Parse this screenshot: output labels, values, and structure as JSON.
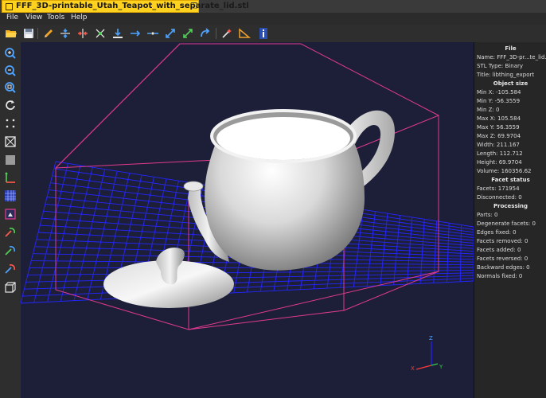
{
  "window": {
    "title": "FFF_3D-printable_Utah_Teapot_with_separate_lid.stl"
  },
  "menu": [
    "File",
    "View",
    "Tools",
    "Help"
  ],
  "toolbar": [
    {
      "name": "open-file-icon"
    },
    {
      "name": "save-file-icon"
    },
    {
      "name": "edit-pencil-icon"
    },
    {
      "name": "mirror-horizontal-icon"
    },
    {
      "name": "mirror-vertical-icon"
    },
    {
      "name": "fix-icon"
    },
    {
      "name": "put-on-bed-icon"
    },
    {
      "name": "translate-icon"
    },
    {
      "name": "center-icon"
    },
    {
      "name": "scale-icon"
    },
    {
      "name": "scale-axis-icon"
    },
    {
      "name": "rotate-icon"
    },
    {
      "name": "repair-icon"
    },
    {
      "name": "measure-icon"
    },
    {
      "name": "info-icon"
    }
  ],
  "left_toolbar": [
    {
      "name": "zoom-in-icon"
    },
    {
      "name": "zoom-out-icon"
    },
    {
      "name": "zoom-fit-icon"
    },
    {
      "name": "reset-view-icon"
    },
    {
      "name": "points-view-icon"
    },
    {
      "name": "wireframe-view-icon"
    },
    {
      "name": "solid-view-icon"
    },
    {
      "name": "axes-icon"
    },
    {
      "name": "grid-icon"
    },
    {
      "name": "bounding-box-icon"
    },
    {
      "name": "rotate-x-icon"
    },
    {
      "name": "rotate-y-icon"
    },
    {
      "name": "rotate-z-icon"
    },
    {
      "name": "perspective-icon"
    }
  ],
  "viewport": {
    "background": "#1d1f38",
    "grid_color": "#2426ff",
    "bbox_color": "#e03a8e",
    "axes": {
      "x": "X",
      "y": "Y",
      "z": "Z"
    }
  },
  "info": {
    "file_header": "File",
    "name": "Name: FFF_3D-pr...te_lid.stl",
    "stl_type": "STL Type: Binary",
    "title": "Title: libthing_export",
    "size_header": "Object size",
    "min_x": "Min X: -105.584",
    "min_y": "Min Y: -56.3559",
    "min_z": "Min Z: 0",
    "max_x": "Max X: 105.584",
    "max_y": "Max Y: 56.3559",
    "max_z": "Max Z: 69.9704",
    "width": "Width: 211.167",
    "length": "Length: 112.712",
    "height": "Height: 69.9704",
    "volume": "Volume: 160356.62",
    "facet_header": "Facet status",
    "facets": "Facets: 171954",
    "disconnected": "Disconnected: 0",
    "proc_header": "Processing",
    "parts": "Parts: 0",
    "degenerate": "Degenerate facets: 0",
    "edges_fixed": "Edges fixed: 0",
    "facets_removed": "Facets removed: 0",
    "facets_added": "Facets added: 0",
    "facets_reversed": "Facets reversed: 0",
    "backward_edges": "Backward edges: 0",
    "normals_fixed": "Normals fixed: 0"
  }
}
